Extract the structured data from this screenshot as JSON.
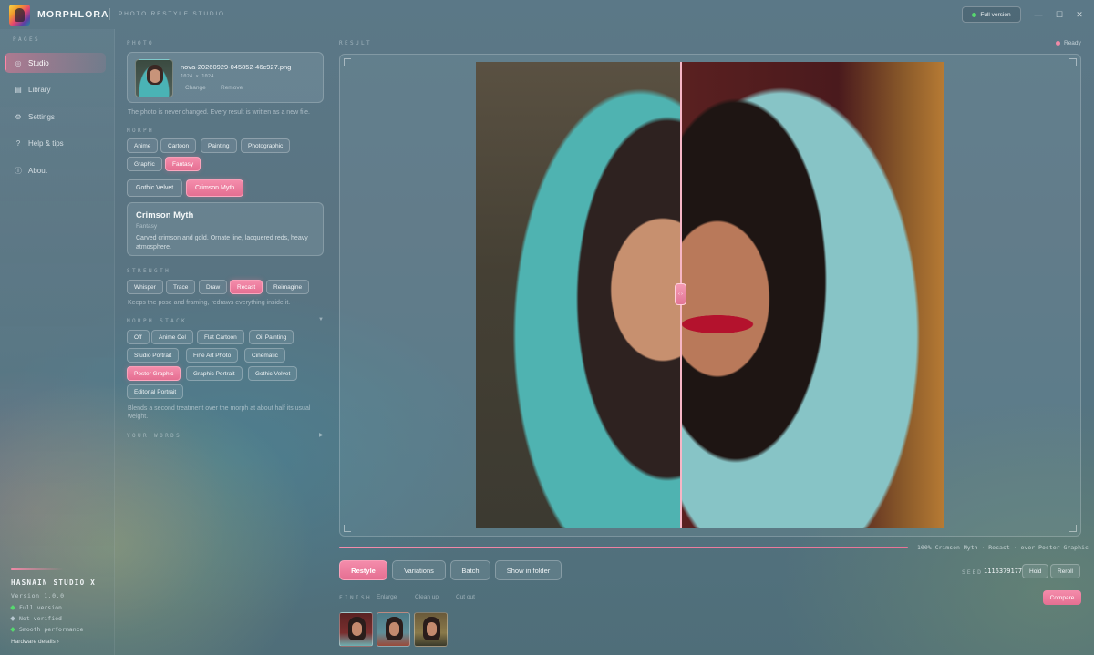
{
  "app": {
    "brand": "MORPHLORA",
    "subtitle": "PHOTO RESTYLE STUDIO",
    "full_version": "Full version"
  },
  "sidebar": {
    "section": "PAGES",
    "items": [
      {
        "label": "Studio",
        "icon": "studio-icon",
        "active": true
      },
      {
        "label": "Library",
        "icon": "library-icon"
      },
      {
        "label": "Settings",
        "icon": "gear-icon"
      },
      {
        "label": "Help & tips",
        "icon": "help-icon"
      },
      {
        "label": "About",
        "icon": "info-icon"
      }
    ],
    "studio_name": "HASNAIN STUDIO X",
    "version": "Version 1.0.0",
    "status": [
      {
        "label": "Full version",
        "color": "#57d86f"
      },
      {
        "label": "Not verified",
        "color": "#b7c7cf"
      },
      {
        "label": "Smooth performance",
        "color": "#57d86f"
      }
    ],
    "hardware_link": "Hardware details ›"
  },
  "photo": {
    "section": "PHOTO",
    "filename": "nova-20260929-045852-46c927.png",
    "dimensions": "1024 × 1024",
    "change": "Change",
    "remove": "Remove",
    "note": "The photo is never changed. Every result is written as a new file."
  },
  "morph": {
    "section": "MORPH",
    "categories": [
      "Anime",
      "Cartoon",
      "Painting",
      "Photographic",
      "Graphic",
      "Fantasy"
    ],
    "active_category": "Fantasy",
    "styles": [
      "Gothic Velvet",
      "Crimson Myth"
    ],
    "active_style": "Crimson Myth",
    "detail": {
      "title": "Crimson Myth",
      "category": "Fantasy",
      "description": "Carved crimson and gold. Ornate line, lacquered reds, heavy atmosphere."
    }
  },
  "strength": {
    "section": "STRENGTH",
    "options": [
      "Whisper",
      "Trace",
      "Draw",
      "Recast",
      "Reimagine"
    ],
    "active": "Recast",
    "note": "Keeps the pose and framing, redraws everything inside it."
  },
  "morph_stack": {
    "section": "MORPH STACK",
    "options": [
      "Off",
      "Anime Cel",
      "Flat Cartoon",
      "Oil Painting",
      "Studio Portrait",
      "Fine Art Photo",
      "Cinematic",
      "Poster Graphic",
      "Graphic Portrait",
      "Gothic Velvet",
      "Editorial Portrait"
    ],
    "active": "Poster Graphic",
    "note": "Blends a second treatment over the morph at about half its usual weight."
  },
  "your_words": {
    "section": "YOUR WORDS"
  },
  "result": {
    "section": "RESULT",
    "status": "Ready",
    "progress_pct": 100,
    "progress_text": "100%  Crimson Myth · Recast · over Poster Graphic",
    "slider_glyph": "‹ ›"
  },
  "actions": {
    "restyle": "Restyle",
    "variations": "Variations",
    "batch": "Batch",
    "show_in_folder": "Show in folder"
  },
  "seed": {
    "label": "SEED",
    "value": "1116379177",
    "hold": "Hold",
    "reroll": "Reroll"
  },
  "finish": {
    "section": "FINISH",
    "options": [
      "Enlarge",
      "Clean up",
      "Cut out"
    ],
    "compare": "Compare"
  },
  "colors": {
    "accent": "#e97497",
    "accent_light": "#f48cab",
    "ok": "#57d86f"
  }
}
